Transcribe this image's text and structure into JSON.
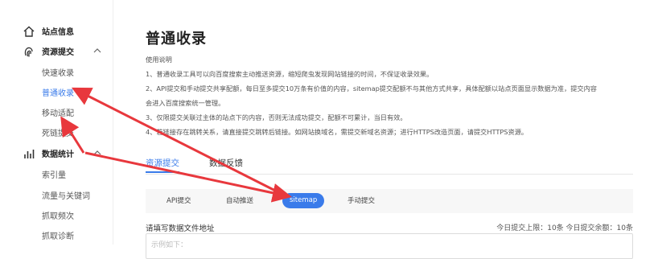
{
  "sidebar": {
    "site_info": {
      "label": "站点信息",
      "icon": "home-icon"
    },
    "resource_submit": {
      "label": "资源提交",
      "icon": "fingerprint-icon",
      "items": [
        {
          "label": "快速收录"
        },
        {
          "label": "普通收录",
          "active": true
        },
        {
          "label": "移动适配"
        },
        {
          "label": "死链提交"
        }
      ]
    },
    "data_stats": {
      "label": "数据统计",
      "icon": "bar-chart-icon",
      "items": [
        {
          "label": "索引量"
        },
        {
          "label": "流量与关键词"
        },
        {
          "label": "抓取频次"
        },
        {
          "label": "抓取诊断"
        }
      ]
    }
  },
  "main": {
    "title": "普通收录",
    "instructions": {
      "heading": "使用说明",
      "lines": [
        "1、普通收录工具可以向百度搜索主动推送资源，缩短爬虫发现网站链接的时间，不保证收录效果。",
        "2、API提交和手动提交共享配额，每日至多提交10万条有价值的内容，sitemap提交配额不与其他方式共享，具体配额以站点页面显示数据为准，提交内容",
        "会进入百度搜索统一管理。",
        "3、仅限提交关联过主体的站点下的内容，否则无法成功提交，配额不可累计，当日有效。",
        "4、若链接存在跳转关系，请直接提交跳转后链接。如网站换域名，需提交新域名资源；进行HTTPS改造页面，请提交HTTPS资源。"
      ]
    },
    "tabs": [
      {
        "label": "资源提交",
        "active": true
      },
      {
        "label": "数据反馈"
      }
    ],
    "subtabs": [
      {
        "label": "API提交"
      },
      {
        "label": "自动推送"
      },
      {
        "label": "sitemap",
        "active": true
      },
      {
        "label": "手动提交"
      }
    ],
    "form": {
      "label": "请填写数据文件地址",
      "quota": "今日提交上限：10条   今日提交余额：10条",
      "placeholder": "示例如下："
    }
  },
  "colors": {
    "accent": "#3a7bea",
    "arrow": "#e8383d"
  }
}
